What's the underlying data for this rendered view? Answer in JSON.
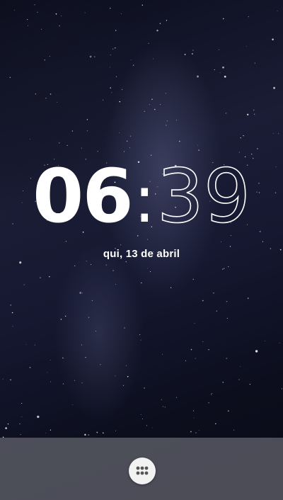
{
  "clock": {
    "hours": "06",
    "separator": ":",
    "minutes": "39"
  },
  "date": {
    "label": "qui, 13 de abril"
  },
  "dock": {
    "apps_icon": "app-drawer-grid-icon"
  },
  "colors": {
    "background": "#0d0f1e",
    "text": "#ffffff",
    "dock": "#5f6069",
    "apps_button": "#f2f2f2"
  }
}
